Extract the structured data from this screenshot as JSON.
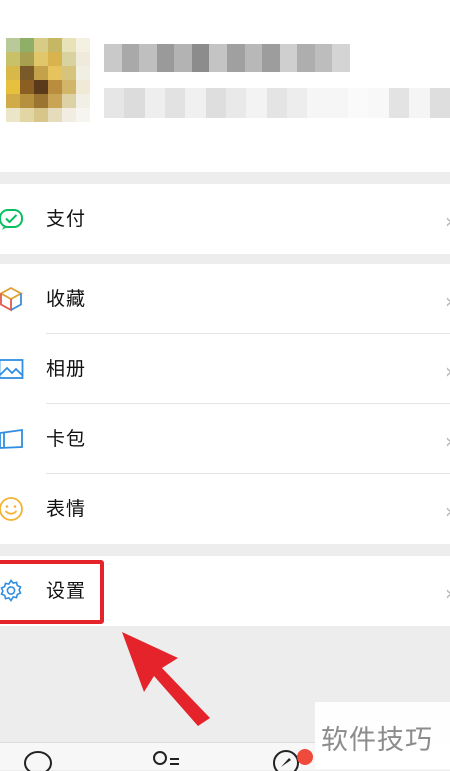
{
  "menu": {
    "pay": "支付",
    "favorites": "收藏",
    "album": "相册",
    "cards": "卡包",
    "stickers": "表情",
    "settings": "设置"
  },
  "chevron": "›",
  "watermark": "软件技巧",
  "colors": {
    "highlight": "#e4232a",
    "pay_icon": "#07c160",
    "background": "#ededed"
  },
  "icons": [
    "pay-icon",
    "favorites-icon",
    "album-icon",
    "cards-icon",
    "stickers-icon",
    "settings-icon",
    "chats-tab-icon",
    "contacts-tab-icon",
    "discover-tab-icon"
  ]
}
